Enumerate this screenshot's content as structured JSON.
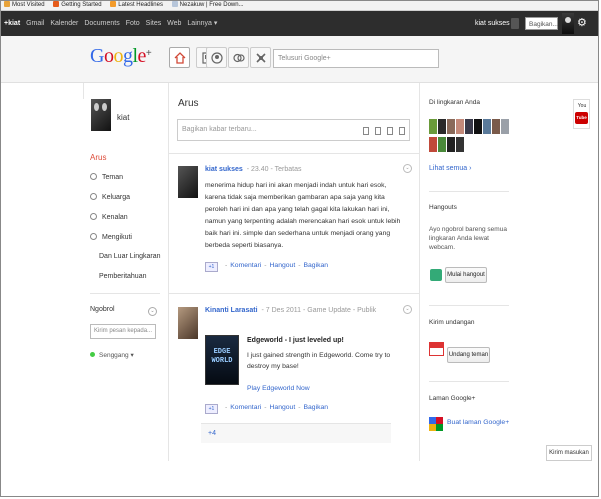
{
  "bookmarks": [
    "Most Visited",
    "Getting Started",
    "Latest Headlines",
    "Nezakuw | Free Down..."
  ],
  "gbar": {
    "items": [
      "+kiat",
      "Gmail",
      "Kalender",
      "Documents",
      "Foto",
      "Sites",
      "Web",
      "Lainnya ▾"
    ],
    "user": "kiat sukses",
    "share_label": "Bagikan..."
  },
  "header": {
    "logo_letters": [
      "G",
      "o",
      "o",
      "g",
      "l",
      "e"
    ],
    "logo_plus": "+",
    "search_placeholder": "Telusuri Google+"
  },
  "profile": {
    "name": "kiat"
  },
  "leftnav": {
    "stream": "Arus",
    "items": [
      "Teman",
      "Keluarga",
      "Kenalan",
      "Mengikuti"
    ],
    "sub_items": [
      "Dan Luar Lingkaran",
      "Pemberitahuan"
    ]
  },
  "chat": {
    "title": "Ngobrol",
    "toggle": "⌄",
    "input_placeholder": "Kirim pesan kepada...",
    "status": "Senggang ▾"
  },
  "stream": {
    "title": "Arus",
    "share_placeholder": "Bagikan kabar terbaru..."
  },
  "posts": [
    {
      "author": "kiat sukses",
      "meta": "- 23.40 - Terbatas",
      "body": "menerima hidup hari ini akan menjadi indah untuk hari esok, karena tidak saja memberikan gambaran apa saja yang kita peroleh hari ini dan apa yang telah gagal kita lakukan hari ini, namun yang terpenting adalah merencakan hari esok untuk lebih baik hari ini. simple dan sederhana untuk menjadi orang yang berbeda seperti biasanya.",
      "actions": {
        "plus": "+1",
        "comment": "Komentari",
        "hangout": "Hangout",
        "share": "Bagikan"
      }
    },
    {
      "author": "Kinanti Larasati",
      "meta": "- 7 Des 2011 - Game Update - Publik",
      "game_image_text": "EDGE WORLD",
      "game_title": "Edgeworld - I just leveled up!",
      "game_desc": "I just gained strength in Edgeworld. Come try to destroy my base!",
      "game_link": "Play Edgeworld Now",
      "actions": {
        "plus": "+1",
        "comment": "Komentari",
        "hangout": "Hangout",
        "share": "Bagikan"
      },
      "plus_count": "+4"
    }
  ],
  "right": {
    "circles_title": "Di lingkaran Anda",
    "see_all": "Lihat semua ›",
    "hangout_title": "Hangouts",
    "hangout_desc": "Ayo ngobrol bareng semua lingkaran Anda lewat webcam.",
    "hangout_button": "Mulai hangout",
    "invite_title": "Kirim undangan",
    "invite_button": "Undang teman",
    "pages_title": "Laman Google+",
    "pages_link": "Buat laman Google+"
  },
  "youtube": {
    "line1": "You",
    "line2": "Tube"
  },
  "feedback": "Kirim masukan",
  "colors": {
    "gbar_bg": "#2d2d2d",
    "link": "#3366cc",
    "stream_active": "#dd4b39"
  }
}
